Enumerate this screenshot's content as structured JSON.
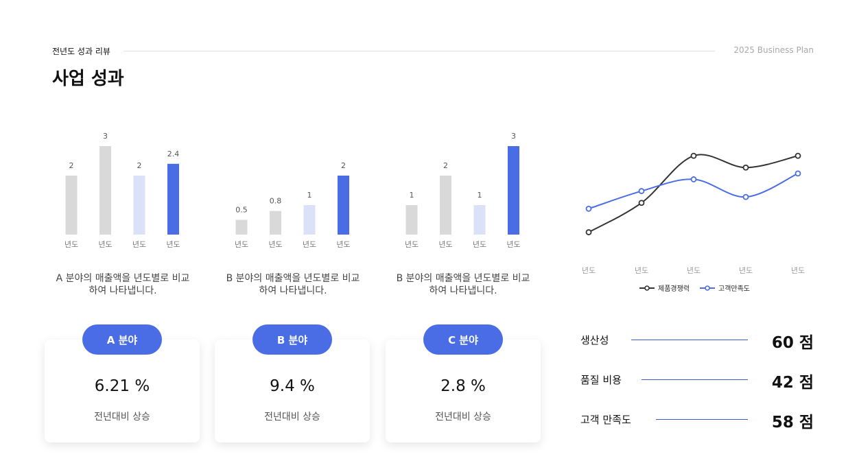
{
  "header": {
    "section_label": "전년도 성과 리뷰",
    "plan_label": "2025 Business Plan",
    "title": "사업 성과"
  },
  "colors": {
    "accent": "#4a6de5",
    "bar_gray": "#d9d9d9",
    "bar_light": "#dbe2f7",
    "line_dark": "#333333",
    "line_blue": "#4a6de5"
  },
  "chart_data": [
    {
      "type": "bar",
      "categories": [
        "년도",
        "년도",
        "년도",
        "년도"
      ],
      "values": [
        2,
        3,
        2,
        2.4
      ],
      "data_labels": [
        "2",
        "3",
        "2",
        "2.4"
      ],
      "bar_colors": [
        "#d9d9d9",
        "#d9d9d9",
        "#dbe2f7",
        "#4a6de5"
      ],
      "ylim": [
        0,
        3
      ],
      "description": "A 분야의 매출액을 년도별로 비교\n하여 나타냅니다."
    },
    {
      "type": "bar",
      "categories": [
        "년도",
        "년도",
        "년도",
        "년도"
      ],
      "values": [
        0.5,
        0.8,
        1,
        2
      ],
      "data_labels": [
        "0.5",
        "0.8",
        "1",
        "2"
      ],
      "bar_colors": [
        "#d9d9d9",
        "#d9d9d9",
        "#dbe2f7",
        "#4a6de5"
      ],
      "ylim": [
        0,
        2.1
      ],
      "description": "B 분야의 매출액을 년도별로 비교\n하여 나타냅니다."
    },
    {
      "type": "bar",
      "categories": [
        "년도",
        "년도",
        "년도",
        "년도"
      ],
      "values": [
        1,
        2,
        1,
        3
      ],
      "data_labels": [
        "1",
        "2",
        "1",
        "3"
      ],
      "bar_colors": [
        "#d9d9d9",
        "#d9d9d9",
        "#dbe2f7",
        "#4a6de5"
      ],
      "ylim": [
        0,
        3
      ],
      "description": "B 분야의 매출액을 년도별로 비교\n하여 나타냅니다."
    },
    {
      "type": "line",
      "categories": [
        "년도",
        "년도",
        "년도",
        "년도",
        "년도"
      ],
      "series": [
        {
          "name": "제품경쟁력",
          "color": "#333333",
          "values": [
            1.0,
            2.0,
            3.6,
            3.2,
            3.6
          ]
        },
        {
          "name": "고객만족도",
          "color": "#4a6de5",
          "values": [
            1.8,
            2.4,
            2.8,
            2.2,
            3.0
          ]
        }
      ],
      "ylim": [
        0.5,
        4.0
      ],
      "legend": "bottom-center"
    }
  ],
  "cards": [
    {
      "label": "A 분야",
      "value": "6.21 %",
      "sub": "전년대비 상승"
    },
    {
      "label": "B 분야",
      "value": "9.4 %",
      "sub": "전년대비 상승"
    },
    {
      "label": "C 분야",
      "value": "2.8 %",
      "sub": "전년대비 상승"
    }
  ],
  "metrics": [
    {
      "label": "생산성",
      "value": "60 점"
    },
    {
      "label": "품질 비용",
      "value": "42 점"
    },
    {
      "label": "고객 만족도",
      "value": "58 점"
    }
  ]
}
